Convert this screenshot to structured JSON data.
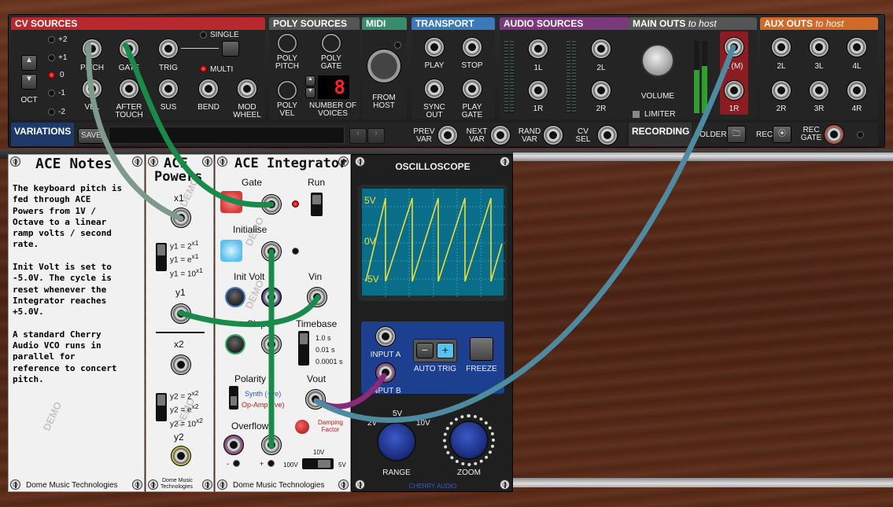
{
  "top_panel": {
    "cv_sources": {
      "title": "CV SOURCES",
      "oct_label": "OCT",
      "oct_options": [
        "+2",
        "+1",
        "0",
        "-1",
        "-2"
      ],
      "jacks_top": [
        "PITCH",
        "GATE",
        "TRIG"
      ],
      "jacks_bottom": [
        "VEL",
        "AFTER TOUCH",
        "SUS",
        "BEND",
        "MOD WHEEL"
      ],
      "single_label": "SINGLE",
      "multi_label": "MULTI"
    },
    "poly_sources": {
      "title": "POLY SOURCES",
      "labels": [
        "POLY PITCH",
        "POLY GATE",
        "POLY VEL",
        "NUMBER OF VOICES"
      ],
      "voices_display": "8"
    },
    "midi": {
      "title": "MIDI",
      "from_host": "FROM HOST"
    },
    "transport": {
      "title": "TRANSPORT",
      "labels": [
        "PLAY",
        "STOP",
        "SYNC OUT",
        "PLAY GATE"
      ]
    },
    "audio_sources": {
      "title": "AUDIO SOURCES",
      "labels": [
        "1L",
        "2L",
        "1R",
        "2R"
      ]
    },
    "main_outs": {
      "title": "MAIN OUTS",
      "title_suffix": "to host",
      "volume": "VOLUME",
      "limiter": "LIMITER",
      "labels": [
        "L (M)",
        "1R"
      ]
    },
    "aux_outs": {
      "title": "AUX OUTS",
      "title_suffix": "to host",
      "labels": [
        "2L",
        "3L",
        "4L",
        "2R",
        "3R",
        "4R"
      ]
    },
    "variations": {
      "title": "VARIATIONS",
      "save": "SAVE",
      "prev": "PREV VAR",
      "next": "NEXT VAR",
      "rand": "RAND VAR",
      "cv": "CV SEL"
    },
    "recording": {
      "title": "RECORDING",
      "folder": "FOLDER",
      "rec": "REC",
      "rec_gate": "REC GATE"
    }
  },
  "notes_module": {
    "title": "ACE Notes",
    "text": "The keyboard pitch is\nfed through ACE\nPowers from 1V /\nOctave to a linear\nramp volts / second\nrate.\n\nInit Volt is set to\n-5.0V. The cycle is\nreset whenever the\nIntegrator reaches\n+5.0V.\n\nA standard Cherry\nAudio VCO runs in\nparallel for\nreference to concert\npitch.",
    "footer": "Dome Music Technologies"
  },
  "powers_module": {
    "title_line1": "ACE",
    "title_line2": "Powers",
    "x1": "x1",
    "y1": "y1",
    "x2": "x2",
    "y2": "y2",
    "footer_line1": "Dome Music",
    "footer_line2": "Technologies"
  },
  "integrator_module": {
    "title": "ACE Integrator",
    "gate": "Gate",
    "run": "Run",
    "initialise": "Initialise",
    "init_volt": "Init Volt",
    "vin": "Vin",
    "slope": "Slope",
    "timebase": "Timebase",
    "timebase_options": [
      "1.0 s",
      "0.01 s",
      "0.0001 s"
    ],
    "polarity": "Polarity",
    "synth": "Synth (+ve)",
    "opamp": "Op-Amp (-ve)",
    "vout": "Vout",
    "overflow": "Overflow",
    "damping": "Damping Factor",
    "v10": "10V",
    "v100": "100V",
    "v5": "5V",
    "footer": "Dome Music Technologies"
  },
  "oscilloscope": {
    "title": "OSCILLOSCOPE",
    "y_labels": [
      "5V",
      "0V",
      "-5V"
    ],
    "input_a": "INPUT A",
    "input_b": "INPUT B",
    "auto_trig": "AUTO TRIG",
    "freeze": "FREEZE",
    "range": "RANGE",
    "zoom": "ZOOM",
    "range_marks": [
      "2V",
      "5V",
      "10V"
    ],
    "brand": "CHERRY AUDIO"
  },
  "watermark": "DEMO",
  "colors": {
    "cv": "#b8282e",
    "poly": "#444444",
    "midi": "#3a8a6e",
    "transport": "#3a7ab8",
    "audio": "#7a3a7a",
    "main": "#555555",
    "aux": "#d06a2a",
    "cable_green": "#1a8a4a",
    "cable_gray": "#7e9a8a",
    "cable_blue": "#4e8aa0",
    "cable_purple": "#8a2a7a"
  }
}
